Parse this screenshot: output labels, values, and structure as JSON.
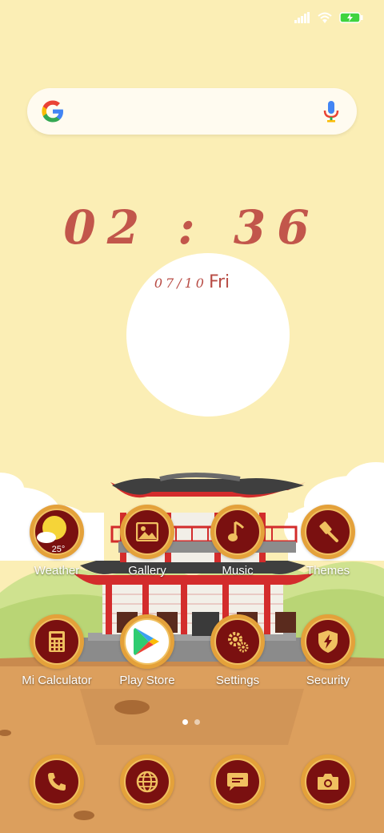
{
  "colors": {
    "sky": "#fbeeb5",
    "ground": "#dc9f5d",
    "accent_red": "#c2564b",
    "icon_fill": "#7a1010",
    "icon_ring": "#e4a13a"
  },
  "status_bar": {
    "icons": [
      "signal-icon",
      "wifi-icon",
      "battery-charging-icon"
    ]
  },
  "search": {
    "icons": [
      "google-logo",
      "mic-icon"
    ]
  },
  "clock": {
    "time": "02 : 36",
    "date": "07/10",
    "day": "Fri"
  },
  "home_apps": [
    {
      "label": "Weather",
      "icon": "weather-icon",
      "temp": "25°"
    },
    {
      "label": "Gallery",
      "icon": "gallery-icon"
    },
    {
      "label": "Music",
      "icon": "music-icon"
    },
    {
      "label": "Themes",
      "icon": "themes-icon"
    },
    {
      "label": "Mi Calculator",
      "icon": "calculator-icon"
    },
    {
      "label": "Play Store",
      "icon": "play-store-icon"
    },
    {
      "label": "Settings",
      "icon": "settings-icon"
    },
    {
      "label": "Security",
      "icon": "security-icon"
    }
  ],
  "page_indicator": {
    "pages": 2,
    "current": 1
  },
  "dock": [
    {
      "icon": "phone-icon"
    },
    {
      "icon": "browser-icon"
    },
    {
      "icon": "messages-icon"
    },
    {
      "icon": "camera-icon"
    }
  ]
}
